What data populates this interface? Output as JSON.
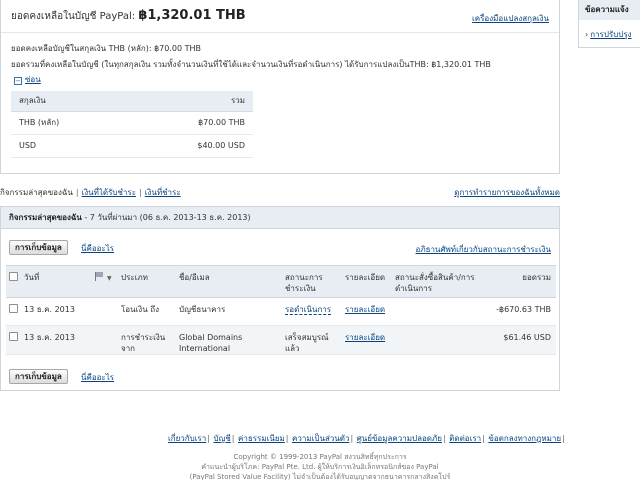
{
  "balance": {
    "label": "ยอดคงเหลือในบัญชี PayPal:",
    "amount": "฿1,320.01 THB",
    "converter_link": "เครื่องมือแปลงสกุลเงิน",
    "line1": "ยอดคงเหลือบัญชีในสกุลเงิน THB (หลัก): ฿70.00 THB",
    "line2": "ยอดรวมที่คงเหลือในบัญชี (ในทุกสกุลเงิน รวมทั้งจำนวนเงินที่ใช้ได้และจำนวนเงินที่รอดำเนินการ) ได้รับการแปลงเป็นTHB: ฿1,320.01 THB",
    "hide_label": "ซ่อน",
    "table": {
      "headers": [
        "สกุลเงิน",
        "รวม"
      ],
      "rows": [
        [
          "THB (หลัก)",
          "฿70.00 THB"
        ],
        [
          "USD",
          "$40.00 USD"
        ]
      ]
    }
  },
  "side": {
    "title": "ข้อความแจ้ง",
    "link": "การปรับปรุง"
  },
  "tabs": {
    "items": [
      "กิจกรรมล่าสุดของฉัน",
      "เงินที่ได้รับชำระ",
      "เงินที่ชำระ"
    ],
    "right_link": "ดูการทำรายการของฉันทั้งหมด"
  },
  "activity": {
    "title": "กิจกรรมล่าสุดของฉัน",
    "subtitle": " - 7 วันที่ผ่านมา (06 ธ.ค. 2013-13 ธ.ค. 2013)",
    "archive_button": "การเก็บข้อมูล",
    "whats_this": "นี่คืออะไร",
    "glossary_link": "อภิธานศัพท์เกี่ยวกับสถานะการชำระเงิน",
    "columns": [
      "วันที่",
      "ประเภท",
      "ชื่อ/อีเมล",
      "สถานะการชำระเงิน",
      "รายละเอียด",
      "สถานะสั่งซื้อสินค้า/การดำเนินการ",
      "ยอดรวม"
    ],
    "rows": [
      {
        "date": "13 ธ.ค. 2013",
        "type": "โอนเงิน ถึง",
        "name": "บัญชีธนาคาร",
        "status": "รอดำเนินการ",
        "details": "รายละเอียด",
        "order_status": "",
        "amount": "-฿670.63 THB"
      },
      {
        "date": "13 ธ.ค. 2013",
        "type": "การชำระเงิน จาก",
        "name": "Global Domains International",
        "status": "เสร็จสมบูรณ์แล้ว",
        "details": "รายละเอียด",
        "order_status": "",
        "amount": "$61.46 USD"
      }
    ]
  },
  "footer": {
    "links": [
      "เกี่ยวกับเรา",
      "บัญชี",
      "ค่าธรรมเนียม",
      "ความเป็นส่วนตัว",
      "ศูนย์ข้อมูลความปลอดภัย",
      "ติดต่อเรา",
      "ข้อตกลงทางกฎหมาย"
    ],
    "copyright": "Copyright © 1999-2013 PayPal สงวนสิทธิ์ทุกประการ",
    "line2": "คำแนะนำผู้บริโภค: PayPal Pte. Ltd. ผู้ให้บริการเงินอิเล็กทรอนิกส์ของ PayPal",
    "line3": "(PayPal Stored Value Facility) ไม่จำเป็นต้องได้รับอนุญาตจากธนาคารกลางสิงคโปร์"
  }
}
